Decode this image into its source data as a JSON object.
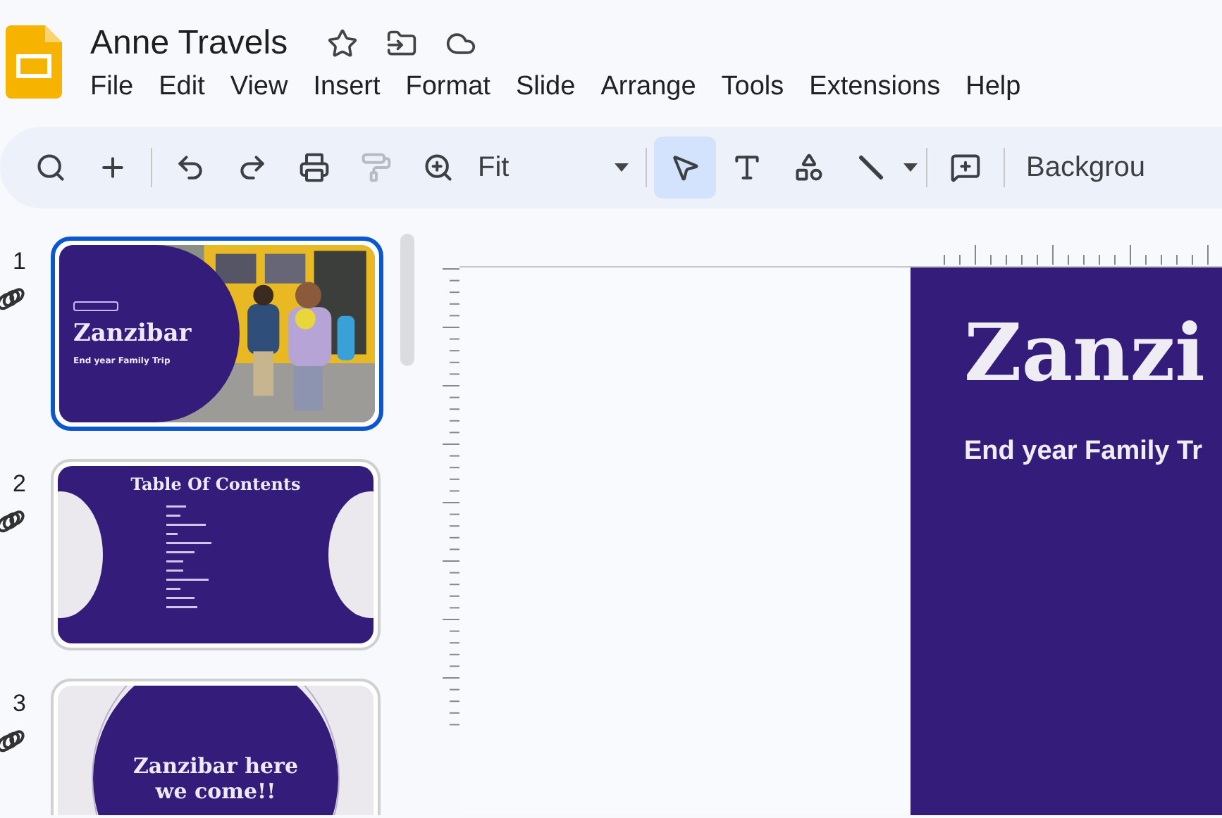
{
  "app": {
    "title": "Anne Travels",
    "menu": [
      "File",
      "Edit",
      "View",
      "Insert",
      "Format",
      "Slide",
      "Arrange",
      "Tools",
      "Extensions",
      "Help"
    ]
  },
  "toolbar": {
    "tools": [
      {
        "kind": "search",
        "selected": false,
        "disabled": false
      },
      {
        "kind": "new",
        "selected": false,
        "disabled": false
      },
      {
        "kind": "divider"
      },
      {
        "kind": "undo",
        "selected": false,
        "disabled": false
      },
      {
        "kind": "redo",
        "selected": false,
        "disabled": false
      },
      {
        "kind": "print",
        "selected": false,
        "disabled": false
      },
      {
        "kind": "paint-format",
        "selected": false,
        "disabled": true
      },
      {
        "kind": "zoom",
        "selected": false,
        "disabled": false
      },
      {
        "kind": "zoom-select",
        "value": "Fit"
      },
      {
        "kind": "divider"
      },
      {
        "kind": "select",
        "selected": true,
        "disabled": false
      },
      {
        "kind": "text-box",
        "selected": false,
        "disabled": false
      },
      {
        "kind": "shape",
        "selected": false,
        "disabled": false
      },
      {
        "kind": "line",
        "selected": false,
        "disabled": false
      },
      {
        "kind": "caret"
      },
      {
        "kind": "divider"
      },
      {
        "kind": "comment",
        "selected": false,
        "disabled": false
      },
      {
        "kind": "divider"
      },
      {
        "kind": "label",
        "text": "Backgrou"
      }
    ]
  },
  "slides": [
    {
      "number": "1",
      "selected": true,
      "kind": "title",
      "title": "Zanzibar",
      "subtitle": "End year Family Trip"
    },
    {
      "number": "2",
      "selected": false,
      "kind": "contents",
      "title": "Table Of Contents"
    },
    {
      "number": "3",
      "selected": false,
      "kind": "section",
      "title": "Zanzibar here we come!!"
    }
  ],
  "canvas": {
    "title": "Zanzi",
    "subtitle": "End year Family Tr"
  }
}
